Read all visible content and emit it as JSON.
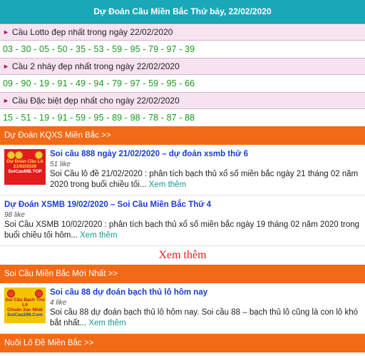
{
  "header": {
    "title": "Dự Đoán Cầu Miền Bắc Thứ bảy, 22/02/2020"
  },
  "predictions": [
    {
      "label": "Cầu Lotto đẹp nhất trong ngày 22/02/2020",
      "numbers": "03 - 30 - 05 - 50 - 35 - 53 - 59 - 95 - 79 - 97 - 39"
    },
    {
      "label": "Cầu 2 nháy đẹp nhất trong ngày 22/02/2020",
      "numbers": "09 - 90 - 19 - 91 - 49 - 94 - 79 - 97 - 59 - 95 - 66"
    },
    {
      "label": "Cầu Đặc biệt đẹp nhất cho ngày 22/02/2020",
      "numbers": "15 - 51 - 19 - 91 - 59 - 95 - 89 - 98 - 78 - 87 - 88"
    }
  ],
  "section1": {
    "title": "Dự Đoán KQXS Miền Bắc >>",
    "articles": [
      {
        "thumb": {
          "line1": "Dự Đoán Cầu Lô",
          "line2": "21/02/2020",
          "line3": "SoiCauMB.TOP"
        },
        "title": "Soi cầu 888 ngày 21/02/2020 – dự đoán xsmb thứ 6",
        "likes": "51 like",
        "desc": "Soi Cầu lô đề 21/02/2020 : phân tích bạch thủ xổ số miền bắc ngày 21 tháng 02 năm 2020 trong buổi chiều tối...",
        "more": "Xem thêm"
      },
      {
        "title": "Dự Đoán XSMB 19/02/2020 – Soi Cầu Miền Bắc Thứ 4",
        "likes": "98 like",
        "desc": "Soi Cầu XSMB 10/02/2020 : phân tích bạch thủ xổ số miền bắc ngày 19 tháng 02 năm 2020 trong buổi chiều tối hôm...",
        "more": "Xem thêm"
      }
    ],
    "see_more": "Xem thêm"
  },
  "section2": {
    "title": "Soi Cầu Miền Bắc Mới Nhất >>",
    "articles": [
      {
        "thumb": {
          "line1": "Soi Cầu Bạch Thủ Lô",
          "line2": "Chuẩn Xác Nhất",
          "line3": "SoiCau299.Com"
        },
        "title": "Soi cầu 88 dự đoán bạch thủ lô hôm nay",
        "likes": "4 like",
        "desc": "Soi cầu 88 dự đoán bạch thủ lô hôm nay. Soi cầu 88 – bạch thủ lô cũng là con lô khó bắt nhất...",
        "more": "Xem thêm"
      }
    ]
  },
  "section3": {
    "title": "Nuôi Lô Đề Miền Bắc >>"
  }
}
